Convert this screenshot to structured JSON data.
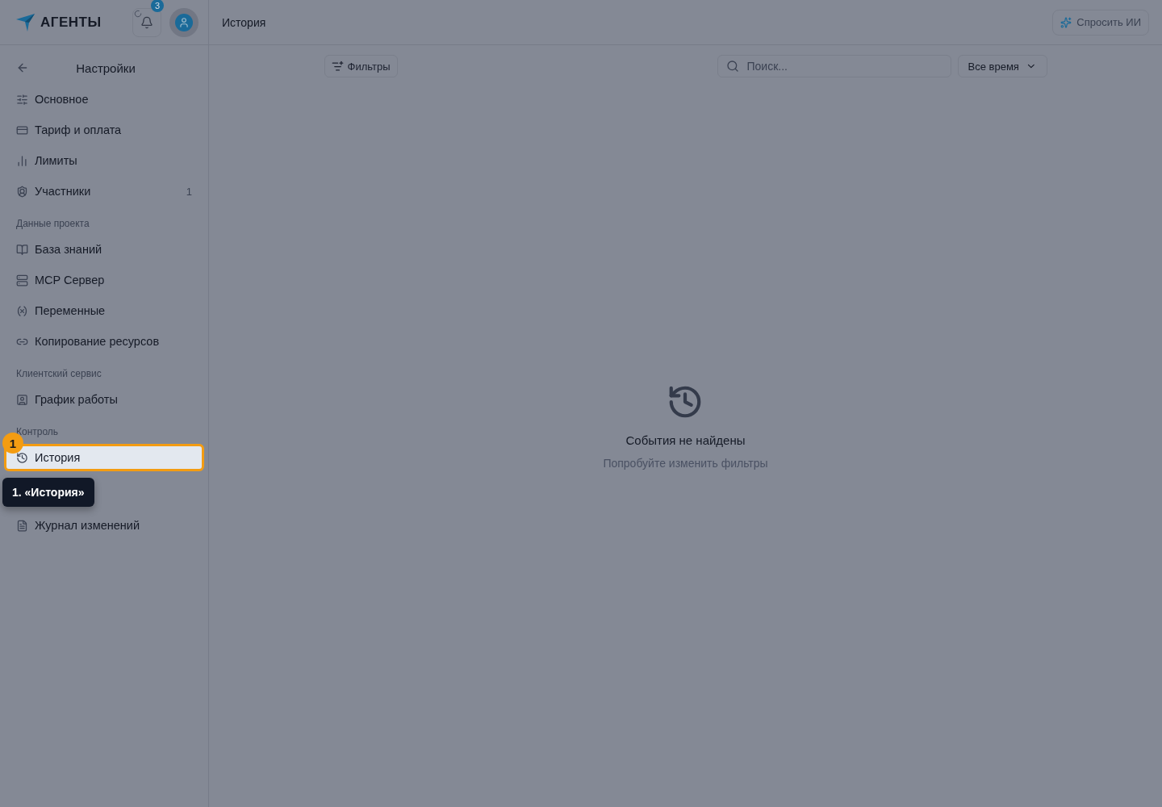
{
  "header": {
    "logo": "АГЕНТЫ",
    "notifications": {
      "count": "3"
    },
    "page_title": "История",
    "ask_ai": "Спросить ИИ"
  },
  "sidebar": {
    "title": "Настройки",
    "sections": [
      {
        "items": [
          {
            "label": "Основное",
            "selected": false
          },
          {
            "label": "Тариф и оплата",
            "selected": false
          },
          {
            "label": "Лимиты",
            "selected": false
          },
          {
            "label": "Участники",
            "count": "1",
            "selected": false
          }
        ]
      },
      {
        "heading": "Данные проекта",
        "items": [
          {
            "label": "База знаний",
            "selected": false
          },
          {
            "label": "MCP Сервер",
            "selected": false
          },
          {
            "label": "Переменные",
            "selected": false
          },
          {
            "label": "Копирование ресурсов",
            "selected": false
          }
        ]
      },
      {
        "heading": "Клиентский сервис",
        "items": [
          {
            "label": "График работы",
            "selected": false
          }
        ]
      },
      {
        "heading": "Контроль",
        "items": [
          {
            "label": "История",
            "selected": true
          },
          {
            "label": "Журнал изменений",
            "selected": false
          }
        ]
      }
    ]
  },
  "toolbar": {
    "filters": "Фильтры",
    "search": {
      "placeholder": "Поиск..."
    },
    "period": "Все время"
  },
  "empty_state": {
    "title": "События не найдены",
    "subtitle": "Попробуйте изменить фильтры"
  },
  "tour": {
    "step": "1",
    "tooltip": "1. «История»"
  }
}
